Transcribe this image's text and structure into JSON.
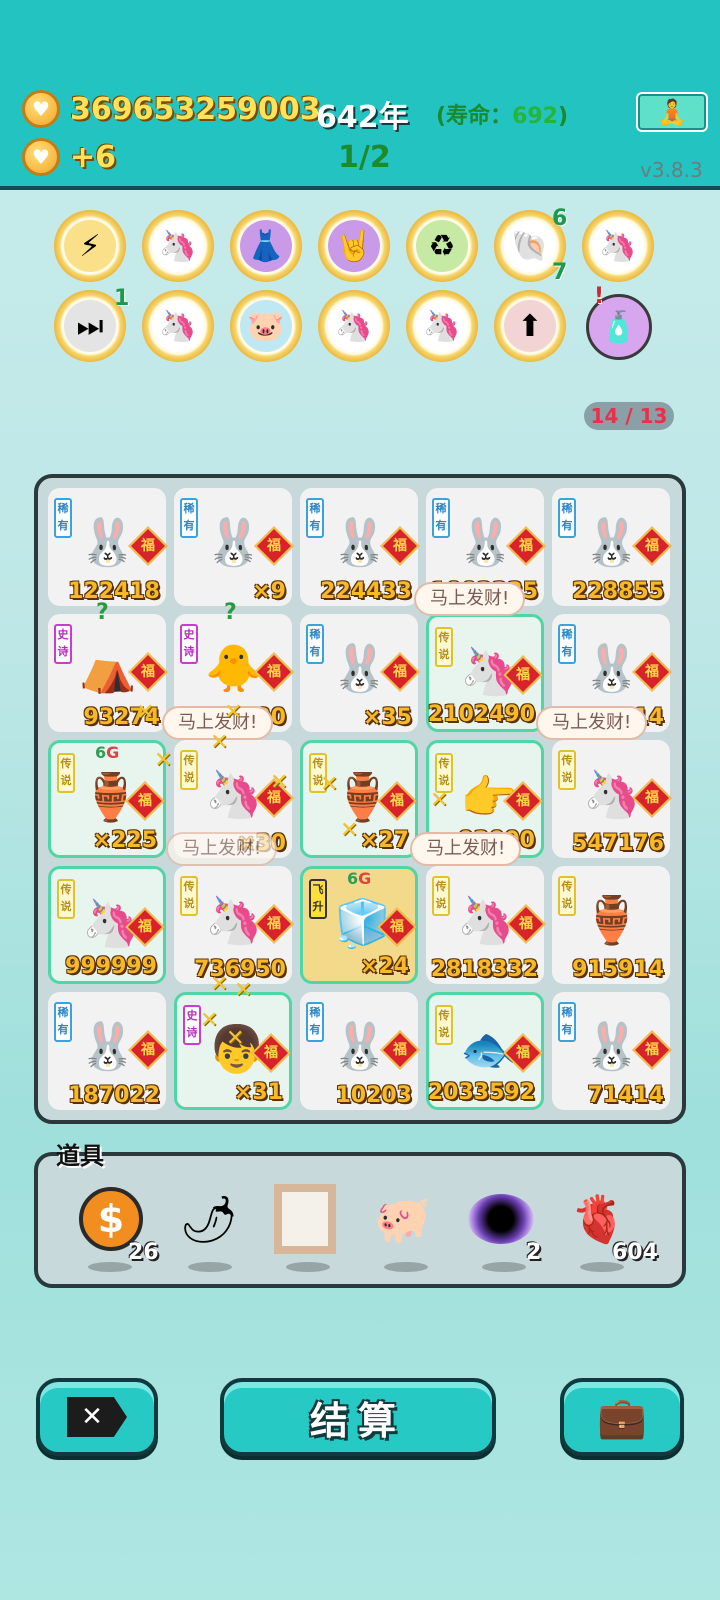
{
  "header": {
    "money": "369653259003",
    "income": "+6",
    "year": "642年",
    "lifespan_label": "(寿命：",
    "lifespan_value": "692",
    "lifespan_close": ")",
    "stage": "1/2",
    "version": "v3.8.3",
    "coin_symbol": "♥"
  },
  "skills": {
    "row1": [
      {
        "icon": "lightning-icon",
        "glyph": "⚡"
      },
      {
        "icon": "unicorn-icon",
        "glyph": "🦄"
      },
      {
        "icon": "skirt-icon",
        "glyph": "👗"
      },
      {
        "icon": "rock-hand-icon",
        "glyph": "🤘"
      },
      {
        "icon": "recycle-icon",
        "glyph": "♻"
      },
      {
        "icon": "shell-icon",
        "glyph": "🐚",
        "badge_top": "6",
        "badge_bottom": "7"
      },
      {
        "icon": "unicorn-icon",
        "glyph": "🦄"
      }
    ],
    "row2": [
      {
        "icon": "skip-icon",
        "glyph": "⏭",
        "badge_top": "1"
      },
      {
        "icon": "unicorn-icon",
        "glyph": "🦄"
      },
      {
        "icon": "piggy-bank-icon",
        "glyph": "🐷"
      },
      {
        "icon": "unicorn-icon",
        "glyph": "🦄"
      },
      {
        "icon": "unicorn-icon",
        "glyph": "🦄"
      },
      {
        "icon": "ascend-icon",
        "glyph": "⬆"
      },
      {
        "icon": "perfume-icon",
        "glyph": "🧴",
        "badge_top": "!"
      }
    ],
    "counter": "14 / 13"
  },
  "board": {
    "cells": [
      {
        "tag": "稀有",
        "char": "🐰",
        "value": "122418"
      },
      {
        "tag": "稀有",
        "char": "🐰",
        "value": "×9"
      },
      {
        "tag": "稀有",
        "char": "🐰",
        "value": "224433"
      },
      {
        "tag": "稀有",
        "char": "🐰",
        "value": "1002225"
      },
      {
        "tag": "稀有",
        "char": "🐰",
        "value": "228855"
      },
      {
        "tag": "史诗",
        "char": "⛺",
        "value": "93274"
      },
      {
        "tag": "史诗",
        "char": "🐥",
        "value": "952920"
      },
      {
        "tag": "稀有",
        "char": "🐰",
        "value": "×35"
      },
      {
        "tag": "传说",
        "char": "🦄",
        "value": "2102490"
      },
      {
        "tag": "稀有",
        "char": "🐰",
        "value": "95314"
      },
      {
        "tag": "传说",
        "char": "🏺",
        "value": "×225"
      },
      {
        "tag": "传说",
        "char": "🦄",
        "value": "×30"
      },
      {
        "tag": "传说",
        "char": "🏺",
        "value": "×27"
      },
      {
        "tag": "传说",
        "char": "👉",
        "value": "92000"
      },
      {
        "tag": "传说",
        "char": "🦄",
        "value": "547176"
      },
      {
        "tag": "传说",
        "char": "🦄",
        "value": "999999"
      },
      {
        "tag": "传说",
        "char": "🦄",
        "value": "736950"
      },
      {
        "tag": "飞升",
        "char": "🧊",
        "value": "×24"
      },
      {
        "tag": "传说",
        "char": "🦄",
        "value": "2818332"
      },
      {
        "tag": "传说",
        "char": "🏺",
        "value": "915914"
      },
      {
        "tag": "稀有",
        "char": "🐰",
        "value": "187022"
      },
      {
        "tag": "史诗",
        "char": "👦",
        "value": "×31"
      },
      {
        "tag": "稀有",
        "char": "🐰",
        "value": "10203"
      },
      {
        "tag": "传说",
        "char": "🐟",
        "value": "2033592"
      },
      {
        "tag": "稀有",
        "char": "🐰",
        "value": "71414"
      }
    ],
    "fu": "福",
    "speech": "马上发财!",
    "sixg_a": "6",
    "sixg_b": "G",
    "question": "?",
    "cross": "✕"
  },
  "items": {
    "title": "道具",
    "list": [
      {
        "icon": "dollar-coin-icon",
        "glyph": "$",
        "count": "26"
      },
      {
        "icon": "chili-pepper-icon",
        "glyph": "🌶",
        "count": ""
      },
      {
        "icon": "frame-icon",
        "glyph": "🖼",
        "count": ""
      },
      {
        "icon": "golden-pig-icon",
        "glyph": "🐖",
        "count": ""
      },
      {
        "icon": "black-hole-icon",
        "glyph": "🌀",
        "count": "2"
      },
      {
        "icon": "liver-icon",
        "glyph": "🫀",
        "count": "604"
      }
    ]
  },
  "buttons": {
    "close_glyph": "✕",
    "settle": "结算",
    "bag_glyph": "💼"
  },
  "colors": {
    "topbar": "#22c3c1",
    "accent_money": "#ffe25a",
    "value_gold": "#f7b928"
  }
}
